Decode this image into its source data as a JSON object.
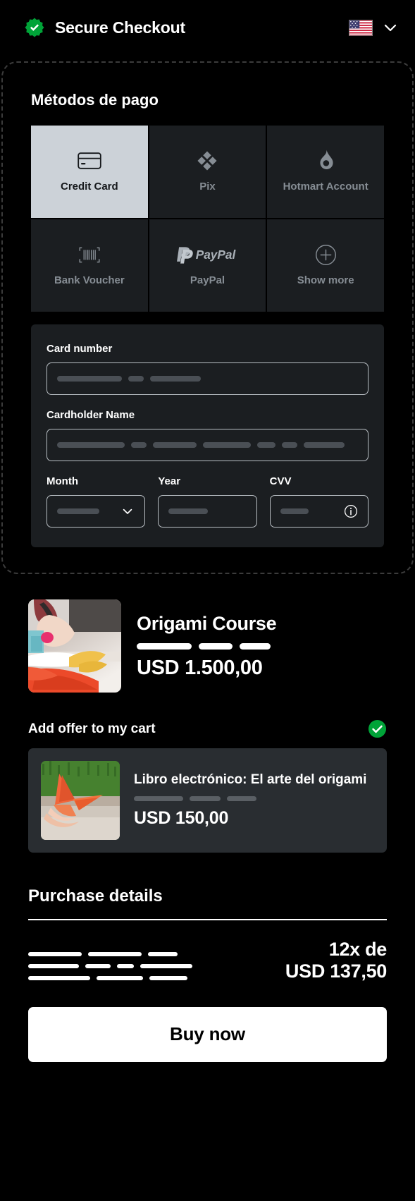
{
  "header": {
    "title": "Secure Checkout",
    "seal_icon": "verified-seal-icon",
    "flag_icon": "us-flag-icon",
    "chevron_icon": "chevron-down-icon",
    "seal_color": "#00a338"
  },
  "payment": {
    "section_title": "Métodos de pago",
    "methods": [
      {
        "label": "Credit Card",
        "icon": "credit-card-icon",
        "selected": true
      },
      {
        "label": "Pix",
        "icon": "pix-icon",
        "selected": false
      },
      {
        "label": "Hotmart Account",
        "icon": "hotmart-flame-icon",
        "selected": false
      },
      {
        "label": "Bank Voucher",
        "icon": "barcode-icon",
        "selected": false
      },
      {
        "label": "PayPal",
        "icon": "paypal-logo-icon",
        "selected": false
      },
      {
        "label": "Show more",
        "icon": "plus-circle-icon",
        "selected": false
      }
    ],
    "form": {
      "card_number_label": "Card number",
      "card_number_value": "",
      "cardholder_label": "Cardholder Name",
      "cardholder_value": "",
      "month_label": "Month",
      "month_value": "",
      "month_icon": "chevron-down-icon",
      "year_label": "Year",
      "year_value": "",
      "cvv_label": "CVV",
      "cvv_value": "",
      "cvv_icon": "info-circle-icon"
    }
  },
  "product": {
    "name": "Origami Course",
    "price": "USD 1.500,00",
    "thumb_alt": "origami-folding-hands-photo"
  },
  "offer": {
    "head_label": "Add offer to my cart",
    "toggle_icon": "check-circle-icon",
    "toggle_color": "#00a338",
    "toggle_state": "checked",
    "title": "Libro electrónico: El arte del origami",
    "price": "USD 150,00",
    "thumb_alt": "orange-paper-crane-photo"
  },
  "details": {
    "title": "Purchase details",
    "installments": "12x de",
    "installment_amount": "USD 137,50"
  },
  "cta": {
    "buy_label": "Buy now"
  },
  "colors": {
    "page_bg": "#000000",
    "tile_bg": "#1b1e21",
    "tile_selected_bg": "#ccd2d8",
    "card_bg": "#1b1e21",
    "offer_card_bg": "#292d31",
    "accent_green": "#00a338",
    "text_primary": "#ffffff",
    "text_muted": "#868d94"
  }
}
